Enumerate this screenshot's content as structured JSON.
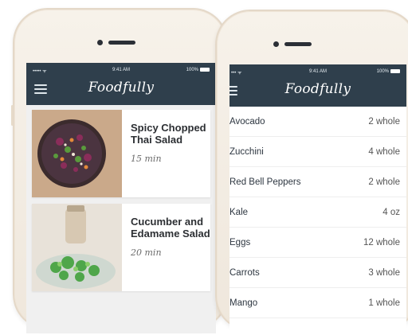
{
  "left_phone": {
    "status": {
      "signal": "••••• ᯤ",
      "time": "9:41 AM",
      "battery": "100%"
    },
    "app_title": "Foodfully",
    "recipes": [
      {
        "title": "Spicy Chopped Thai Salad",
        "time": "15 min"
      },
      {
        "title": "Cucumber and Edamame Salad",
        "time": "20 min"
      }
    ]
  },
  "right_phone": {
    "status": {
      "signal": "••• ᯤ",
      "time": "9:41 AM",
      "battery": "100%"
    },
    "app_title": "Foodfully",
    "ingredients": [
      {
        "name": "Avocado",
        "qty": "2 whole"
      },
      {
        "name": "Zucchini",
        "qty": "4 whole"
      },
      {
        "name": "Red Bell Peppers",
        "qty": "2 whole"
      },
      {
        "name": "Kale",
        "qty": "4 oz"
      },
      {
        "name": "Eggs",
        "qty": "12 whole"
      },
      {
        "name": "Carrots",
        "qty": "3 whole"
      },
      {
        "name": "Mango",
        "qty": "1 whole"
      }
    ]
  },
  "colors": {
    "header": "#2f3f4c",
    "phone_body": "#f3ece2",
    "background": "#ffffff"
  },
  "icons": [
    "menu-icon",
    "signal-icon",
    "battery-icon"
  ]
}
